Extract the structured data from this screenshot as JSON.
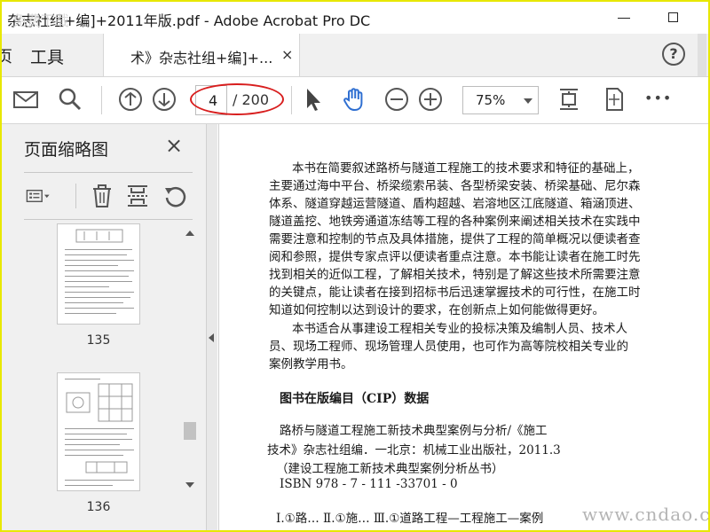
{
  "window": {
    "title": "杂志社组+编]+2011年版.pdf - Adobe Acrobat Pro DC",
    "title_leading_glyph": "←",
    "overlay_mark": "免费下载"
  },
  "tabs": {
    "left_cut": "页",
    "tools_label": "工具",
    "document_tab_label": "术》杂志社组+编]+...",
    "close_symbol": "×",
    "help_symbol": "?"
  },
  "toolbar": {
    "current_page": "4",
    "total_pages": "/ 200",
    "zoom": "75%",
    "more_symbol": "•••"
  },
  "panel": {
    "title": "页面缩略图",
    "close_symbol": "×",
    "thumbnails": [
      {
        "page_label": "135"
      },
      {
        "page_label": "136"
      }
    ]
  },
  "document": {
    "paragraph1": [
      "本书在简要叙述路桥与隧道工程施工的技术要求和特征的基础上，",
      "主要通过海中平台、桥梁缆索吊装、各型桥梁安装、桥梁基础、尼尔森",
      "体系、隧道穿越运营隧道、盾构超越、岩溶地区江底隧道、箱涵顶进、",
      "隧道盖挖、地铁旁通道冻结等工程的各种案例来阐述相关技术在实践中",
      "需要注意和控制的节点及具体措施，提供了工程的简单概况以便读者查",
      "阅和参照，提供专家点评以便读者重点注意。本书能让读者在施工时先",
      "找到相关的近似工程，了解相关技术，特别是了解这些技术所需要注意",
      "的关键点，能让读者在接到招标书后迅速掌握技术的可行性，在施工时",
      "知道如何控制以达到设计的要求，在创新点上如何能做得更好。"
    ],
    "paragraph2": [
      "本书适合从事建设工程相关专业的投标决策及编制人员、技术人",
      "员、现场工程师、现场管理人员使用，也可作为高等院校相关专业的",
      "案例教学用书。"
    ],
    "cip_heading": "图书在版编目（CIP）数据",
    "cip_lines": [
      "路桥与隧道工程施工新技术典型案例与分析/《施工",
      "技术》杂志社组编．一北京：机械工业出版社，2011.3",
      "（建设工程施工新技术典型案例分析丛书）",
      "ISBN 978 - 7 - 111 -33701 - 0",
      "Ⅰ.①路…  Ⅱ.①施…  Ⅲ.①道路工程—工程施工—案例"
    ]
  },
  "watermark": "www.cndao.com",
  "colors": {
    "frame_border": "#e8e800",
    "annotation_red": "#d81e1e",
    "hand_tool_blue": "#2f6fd1",
    "panel_bg": "#f0f0f0"
  },
  "icons": [
    "mail-icon",
    "search-icon",
    "page-up-icon",
    "page-down-icon",
    "select-cursor-icon",
    "hand-tool-icon",
    "zoom-out-icon",
    "zoom-in-icon",
    "fit-page-icon",
    "rotate-page-icon",
    "more-icon",
    "thumbnail-options-icon",
    "trash-icon",
    "extract-icon",
    "undo-icon"
  ]
}
